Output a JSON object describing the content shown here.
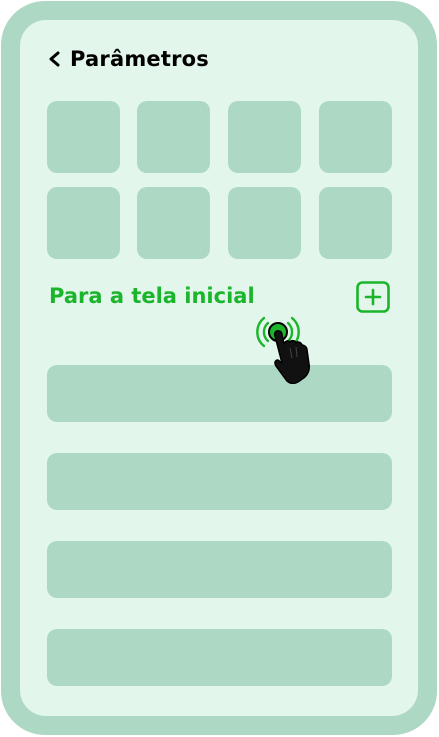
{
  "header": {
    "back_icon": "chevron-left-icon",
    "title": "Parâmetros"
  },
  "grid": {
    "tiles": 8
  },
  "section": {
    "label": "Para a tela inicial",
    "add_icon": "plus-box-icon"
  },
  "list": {
    "rows": 4
  },
  "colors": {
    "frame": "#add8c3",
    "screen": "#e2f6eb",
    "accent": "#1bb52b"
  },
  "overlay": {
    "cursor_icon": "tap-hand-icon"
  }
}
